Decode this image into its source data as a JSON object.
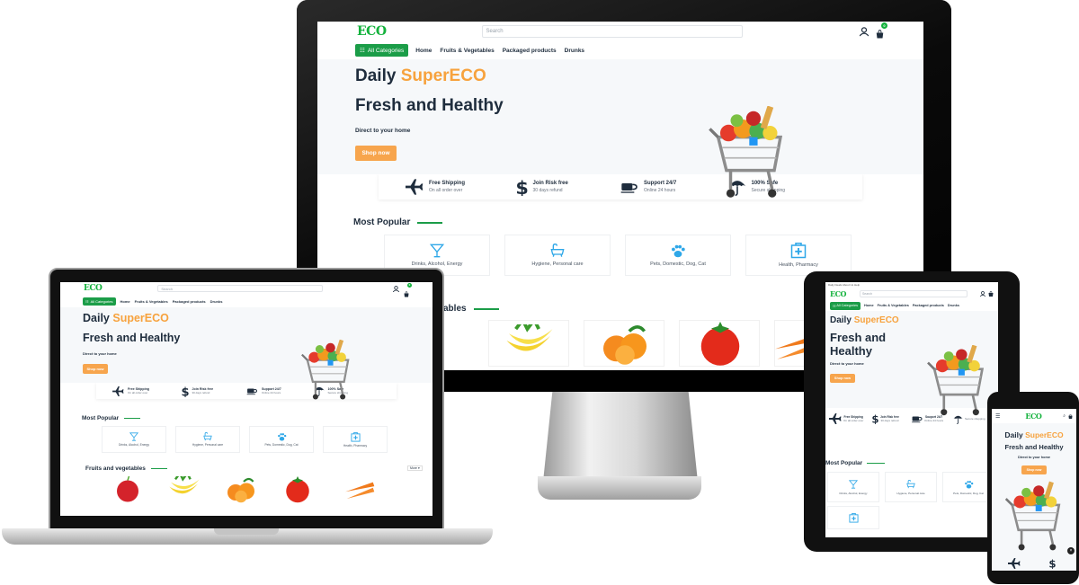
{
  "brand": {
    "logo": "ECO",
    "accent_color": "#f7a23d",
    "brand_green": "#13b23c",
    "button_green": "#1b9d48"
  },
  "header": {
    "search_placeholder": "Search",
    "cart_count": "0"
  },
  "nav": {
    "all_categories": "All Categories",
    "links": [
      "Home",
      "Fruits & Vegetables",
      "Packaged products",
      "Drunks"
    ]
  },
  "hero": {
    "line1_prefix": "Daily ",
    "line1_accent": "SuperECO",
    "line2": "Fresh and Healthy",
    "line2_a": "Fresh and",
    "line2_b": "Healthy",
    "subtitle": "Direct to your home",
    "cta": "Shop now"
  },
  "features": [
    {
      "icon": "plane-icon",
      "title": "Free Shipping",
      "sub": "On all order over"
    },
    {
      "icon": "dollar-icon",
      "title": "Join Risk free",
      "sub": "30 days refund"
    },
    {
      "icon": "coffee-icon",
      "title": "Support 24/7",
      "sub": "Online 24 hours"
    },
    {
      "icon": "umbrella-icon",
      "title": "100% Safe",
      "sub": "Secure shopping"
    }
  ],
  "tablet_features": [
    {
      "title": "Free Shipping",
      "sub": "On all order over"
    },
    {
      "title": "Join Risk free",
      "sub": "30 days refund"
    },
    {
      "title": "Sauport 24/7",
      "sub": "Online 24 hours"
    },
    {
      "title": "",
      "sub": "Secure shopping"
    }
  ],
  "most_popular": {
    "title": "Most Popular",
    "items": [
      {
        "icon": "cocktail-icon",
        "label": "Drinks, Alcohol, Energy"
      },
      {
        "icon": "bathtub-icon",
        "label": "Hygiene, Personal care"
      },
      {
        "icon": "paw-icon",
        "label": "Pets, Domestic, Dog, Cat"
      },
      {
        "icon": "medkit-icon",
        "label": "Health, Pharmacy"
      }
    ]
  },
  "fruits": {
    "title": "Fruits and vegetables",
    "title_fragment": "ables",
    "more": "More"
  },
  "tablet_topline": "Daily Deals  About Us  Help"
}
